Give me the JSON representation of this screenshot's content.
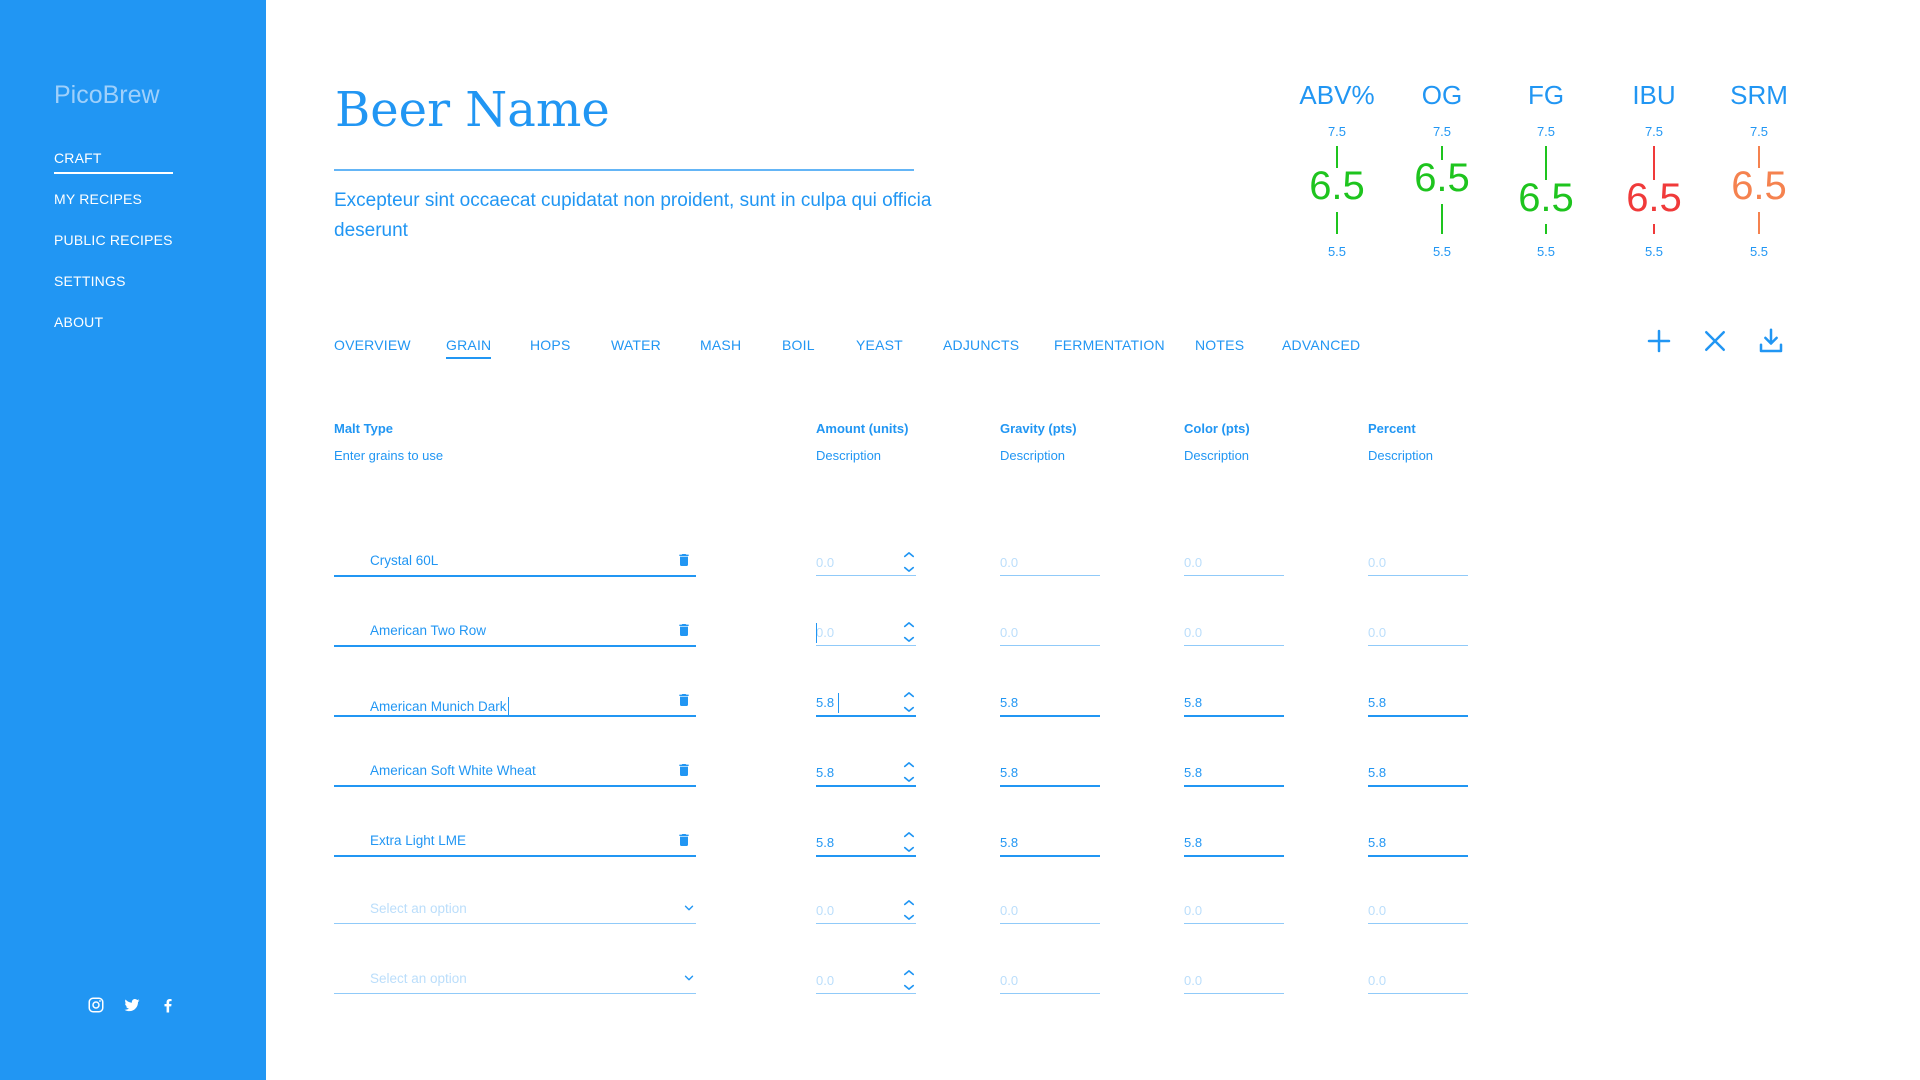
{
  "sidebar": {
    "brand": "PicoBrew",
    "nav": [
      "CRAFT",
      "MY RECIPES",
      "PUBLIC RECIPES",
      "SETTINGS",
      "ABOUT"
    ],
    "social": [
      "instagram-icon",
      "twitter-icon",
      "facebook-icon"
    ]
  },
  "recipe": {
    "name": "Beer Name",
    "description": "Excepteur sint occaecat cupidatat non proident, sunt in culpa qui officia deserunt"
  },
  "stats": [
    {
      "label": "ABV%",
      "max": "7.5",
      "value": "6.5",
      "min": "5.5",
      "color": "#1ec41e"
    },
    {
      "label": "OG",
      "max": "7.5",
      "value": "6.5",
      "min": "5.5",
      "color": "#1ec41e"
    },
    {
      "label": "FG",
      "max": "7.5",
      "value": "6.5",
      "min": "5.5",
      "color": "#1ec41e"
    },
    {
      "label": "IBU",
      "max": "7.5",
      "value": "6.5",
      "min": "5.5",
      "color": "#f03a3a"
    },
    {
      "label": "SRM",
      "max": "7.5",
      "value": "6.5",
      "min": "5.5",
      "color": "#f5824f"
    }
  ],
  "tabs": [
    "OVERVIEW",
    "GRAIN",
    "HOPS",
    "WATER",
    "MASH",
    "BOIL",
    "YEAST",
    "ADJUNCTS",
    "FERMENTATION",
    "NOTES",
    "ADVANCED"
  ],
  "active_tab": "GRAIN",
  "actions": [
    "plus-icon",
    "close-icon",
    "download-icon"
  ],
  "columns": [
    {
      "title": "Malt Type",
      "desc": "Enter grains to use"
    },
    {
      "title": "Amount (units)",
      "desc": "Description"
    },
    {
      "title": "Gravity (pts)",
      "desc": "Description"
    },
    {
      "title": "Color (pts)",
      "desc": "Description"
    },
    {
      "title": "Percent",
      "desc": "Description"
    }
  ],
  "rows": [
    {
      "malt": "Crystal 60L",
      "amount": "",
      "gravity": "",
      "color": "",
      "percent": ""
    },
    {
      "malt": "American Two Row",
      "amount": "",
      "gravity": "",
      "color": "",
      "percent": ""
    },
    {
      "malt": "American Munich Dark",
      "amount": "5.8",
      "gravity": "5.8",
      "color": "5.8",
      "percent": "5.8"
    },
    {
      "malt": "American Soft White Wheat",
      "amount": "5.8",
      "gravity": "5.8",
      "color": "5.8",
      "percent": "5.8"
    },
    {
      "malt": "Extra Light LME",
      "amount": "5.8",
      "gravity": "5.8",
      "color": "5.8",
      "percent": "5.8"
    },
    {
      "malt": "",
      "amount": "",
      "gravity": "",
      "color": "",
      "percent": ""
    },
    {
      "malt": "",
      "amount": "",
      "gravity": "",
      "color": "",
      "percent": ""
    }
  ],
  "placeholders": {
    "malt": "Select an option",
    "number": "0.0"
  }
}
